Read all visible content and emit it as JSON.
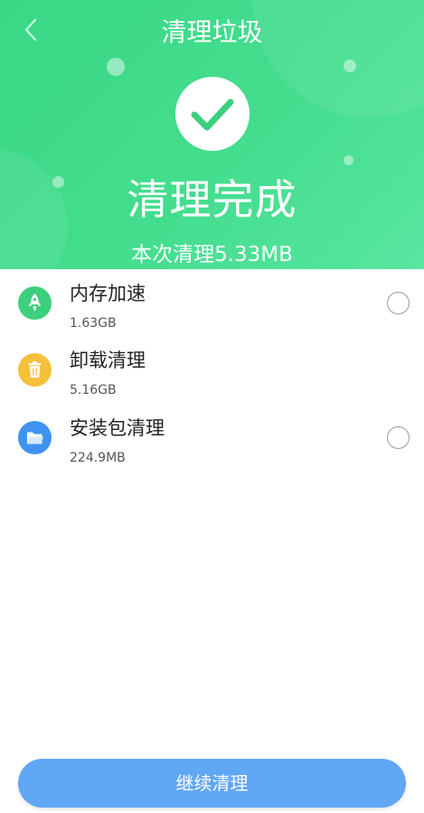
{
  "header": {
    "title": "清理垃圾",
    "result_title": "清理完成",
    "result_summary": "本次清理5.33MB",
    "back_icon": "chevron-left-icon",
    "status_icon": "checkmark-icon"
  },
  "items": [
    {
      "name": "内存加速",
      "size": "1.63GB",
      "icon": "rocket-icon",
      "icon_color": "#3ccf7d",
      "selected": false
    },
    {
      "name": "卸载清理",
      "size": "5.16GB",
      "icon": "trash-icon",
      "icon_color": "#f5c13a",
      "selected": false
    },
    {
      "name": "安装包清理",
      "size": "224.9MB",
      "icon": "folder-icon",
      "icon_color": "#3f93f0",
      "selected": false
    }
  ],
  "footer": {
    "button_label": "继续清理"
  },
  "colors": {
    "header_green": "#44dd8e",
    "button_blue": "#60a7f6"
  }
}
